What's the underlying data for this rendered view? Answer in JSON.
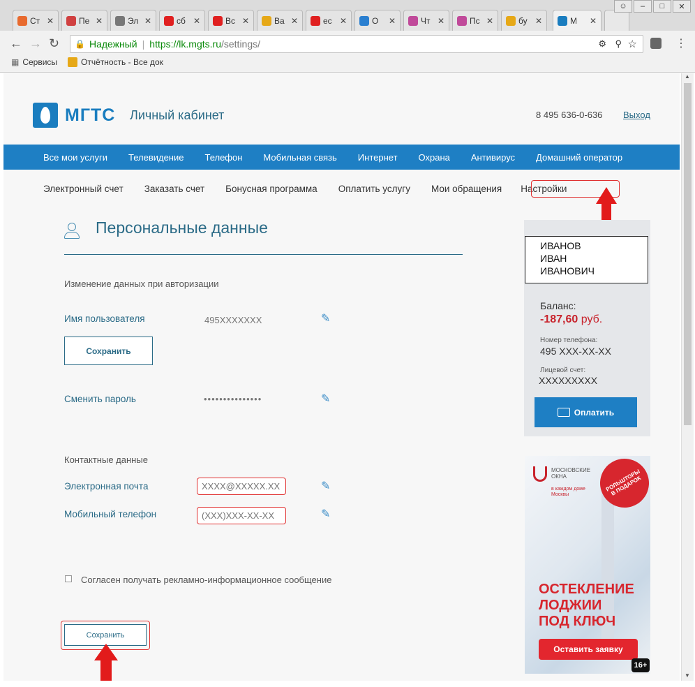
{
  "browser": {
    "tabs": [
      {
        "label": "Ст",
        "color": "#e86a2e"
      },
      {
        "label": "Пе",
        "color": "#d04040"
      },
      {
        "label": "Эл",
        "color": "#777777"
      },
      {
        "label": "сб",
        "color": "#e02020"
      },
      {
        "label": "Вс",
        "color": "#e02020"
      },
      {
        "label": "Ва",
        "color": "#e6a817"
      },
      {
        "label": "ес",
        "color": "#e02020"
      },
      {
        "label": "О",
        "color": "#2a7fd0"
      },
      {
        "label": "Чт",
        "color": "#c04a9a"
      },
      {
        "label": "Пс",
        "color": "#c04a9a"
      },
      {
        "label": "бу",
        "color": "#e6a817"
      },
      {
        "label": "М",
        "color": "#1a7dbf"
      }
    ],
    "secure_label": "Надежный",
    "url_host": "https://lk.mgts.ru",
    "url_path": "/settings/",
    "bookmarks": [
      {
        "label": "Сервисы"
      },
      {
        "label": "Отчётность - Все док"
      }
    ]
  },
  "header": {
    "brand": "МГТС",
    "cabinet": "Личный кабинет",
    "phone": "8 495 636-0-636",
    "logout": "Выход"
  },
  "menu": [
    "Все мои услуги",
    "Телевидение",
    "Телефон",
    "Мобильная связь",
    "Интернет",
    "Охрана",
    "Антивирус",
    "Домашний оператор"
  ],
  "submenu": [
    "Электронный счет",
    "Заказать счет",
    "Бонусная программа",
    "Оплатить услугу",
    "Мои обращения",
    "Настройки"
  ],
  "settings": {
    "title": "Персональные данные",
    "auth_section": "Изменение данных при авторизации",
    "username_label": "Имя пользователя",
    "username_value": "495XXXXXXX",
    "save_label": "Сохранить",
    "password_label": "Сменить пароль",
    "password_value": "•••••••••••••••",
    "contact_section": "Контактные данные",
    "email_label": "Электронная почта",
    "email_placeholder": "XXXX@XXXXX.XX",
    "phone_label": "Мобильный телефон",
    "phone_placeholder": "(XXX)XXX-XX-XX",
    "consent_label": "Согласен получать рекламно-информационное сообщение",
    "save_bottom_label": "Сохранить"
  },
  "account": {
    "name_lines": [
      "ИВАНОВ",
      "ИВАН",
      "ИВАНОВИЧ"
    ],
    "balance_label": "Баланс:",
    "balance_value": "-187,60",
    "balance_unit": "руб.",
    "phone_label": "Номер телефона:",
    "phone_value": "495 XXX-XX-XX",
    "account_label": "Лицевой счет:",
    "account_value": "XXXXXXXXX",
    "pay_label": "Оплатить"
  },
  "ad": {
    "brand": "МОСКОВСКИЕ ОКНА",
    "tagline": "в каждом доме Москвы",
    "badge": "РОЛЬШТОРЫ В ПОДАРОК",
    "headline": [
      "ОСТЕКЛЕНИЕ",
      "ЛОДЖИИ",
      "ПОД КЛЮЧ"
    ],
    "cta": "Оставить заявку",
    "age": "16+"
  }
}
